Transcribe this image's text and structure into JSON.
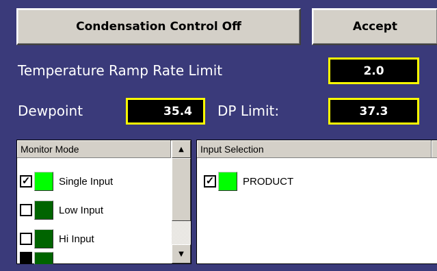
{
  "buttons": {
    "condensation": "Condensation Control Off",
    "accept": "Accept"
  },
  "ramp": {
    "label": "Temperature Ramp Rate Limit",
    "value": "2.0"
  },
  "dewpoint": {
    "label": "Dewpoint",
    "value": "35.4",
    "limit_label": "DP Limit:",
    "limit_value": "37.3"
  },
  "monitor": {
    "header": "Monitor Mode",
    "items": [
      {
        "label": "Single Input",
        "checked": true,
        "color": "#00ff00"
      },
      {
        "label": "Low Input",
        "checked": false,
        "color": "#006400"
      },
      {
        "label": "Hi Input",
        "checked": false,
        "color": "#006400"
      },
      {
        "label": "",
        "checked": true,
        "color": "#006400"
      }
    ]
  },
  "input_selection": {
    "header": "Input Selection",
    "items": [
      {
        "label": "PRODUCT",
        "checked": true,
        "color": "#00ff00"
      }
    ]
  },
  "colors": {
    "background": "#3a3a7a",
    "value_border": "#ffff00",
    "active_swatch": "#00ff00",
    "inactive_swatch": "#006400"
  }
}
